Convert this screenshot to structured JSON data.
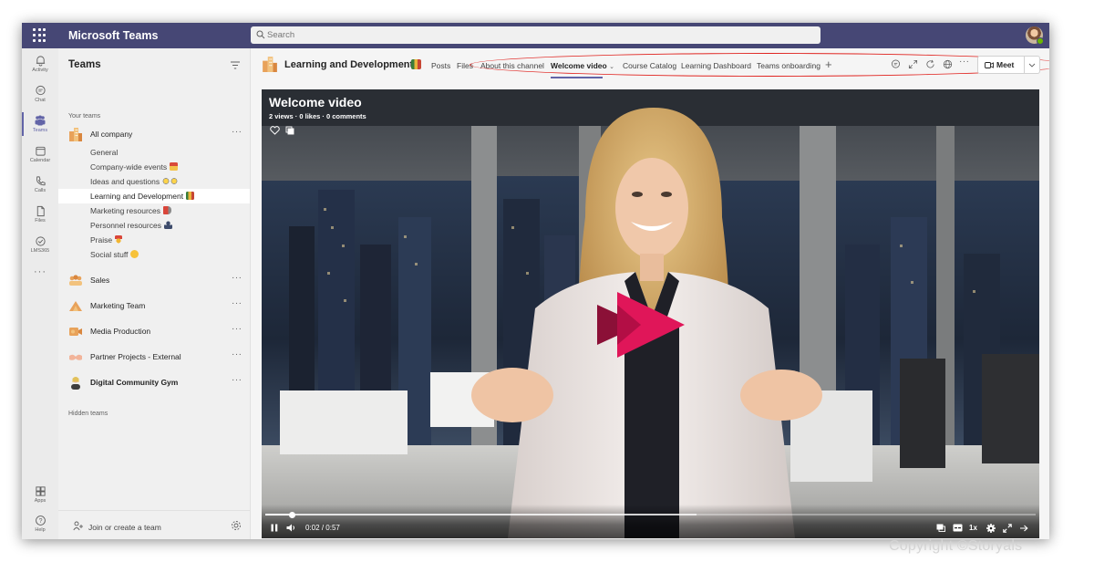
{
  "app": {
    "name": "Microsoft Teams"
  },
  "search": {
    "placeholder": "Search"
  },
  "rail": {
    "items": [
      {
        "label": "Activity",
        "icon": "bell-icon"
      },
      {
        "label": "Chat",
        "icon": "chat-icon"
      },
      {
        "label": "Teams",
        "icon": "teams-icon"
      },
      {
        "label": "Calendar",
        "icon": "calendar-icon"
      },
      {
        "label": "Calls",
        "icon": "phone-icon"
      },
      {
        "label": "Files",
        "icon": "file-icon"
      },
      {
        "label": "LMS365",
        "icon": "lms-icon"
      },
      {
        "label": "Apps",
        "icon": "apps-icon"
      },
      {
        "label": "Help",
        "icon": "help-icon"
      }
    ],
    "active": "Teams"
  },
  "pane": {
    "title": "Teams",
    "your_teams_label": "Your teams",
    "hidden_teams_label": "Hidden teams",
    "join_label": "Join or create a team",
    "all_company": {
      "name": "All company"
    },
    "channels": [
      {
        "name": "General"
      },
      {
        "name": "Company-wide events"
      },
      {
        "name": "Ideas and questions"
      },
      {
        "name": "Learning and Development"
      },
      {
        "name": "Marketing resources"
      },
      {
        "name": "Personnel resources"
      },
      {
        "name": "Praise"
      },
      {
        "name": "Social stuff"
      }
    ],
    "teams": [
      {
        "name": "Sales"
      },
      {
        "name": "Marketing Team"
      },
      {
        "name": "Media Production"
      },
      {
        "name": "Partner Projects - External"
      },
      {
        "name": "Digital Community Gym"
      }
    ]
  },
  "channel": {
    "title": "Learning and Development",
    "tabs": [
      {
        "label": "Posts"
      },
      {
        "label": "Files"
      },
      {
        "label": "About this channel"
      },
      {
        "label": "Welcome video"
      },
      {
        "label": "Course Catalog"
      },
      {
        "label": "Learning Dashboard"
      },
      {
        "label": "Teams onboarding"
      }
    ],
    "active_tab": "Welcome video",
    "meet_label": "Meet"
  },
  "video": {
    "title": "Welcome video",
    "stats": "2 views · 0 likes · 0 comments",
    "current_time": "0:02",
    "time_separator": "/",
    "duration": "0:57",
    "speed": "1x",
    "progress_fraction": 0.035,
    "buffered_fraction": 0.56
  },
  "colors": {
    "brand": "#6264a7",
    "topbar": "#464775",
    "stream_play": "#c30052",
    "annotation": "#e0231f"
  },
  "copyright": "Copyright ©Storyals"
}
